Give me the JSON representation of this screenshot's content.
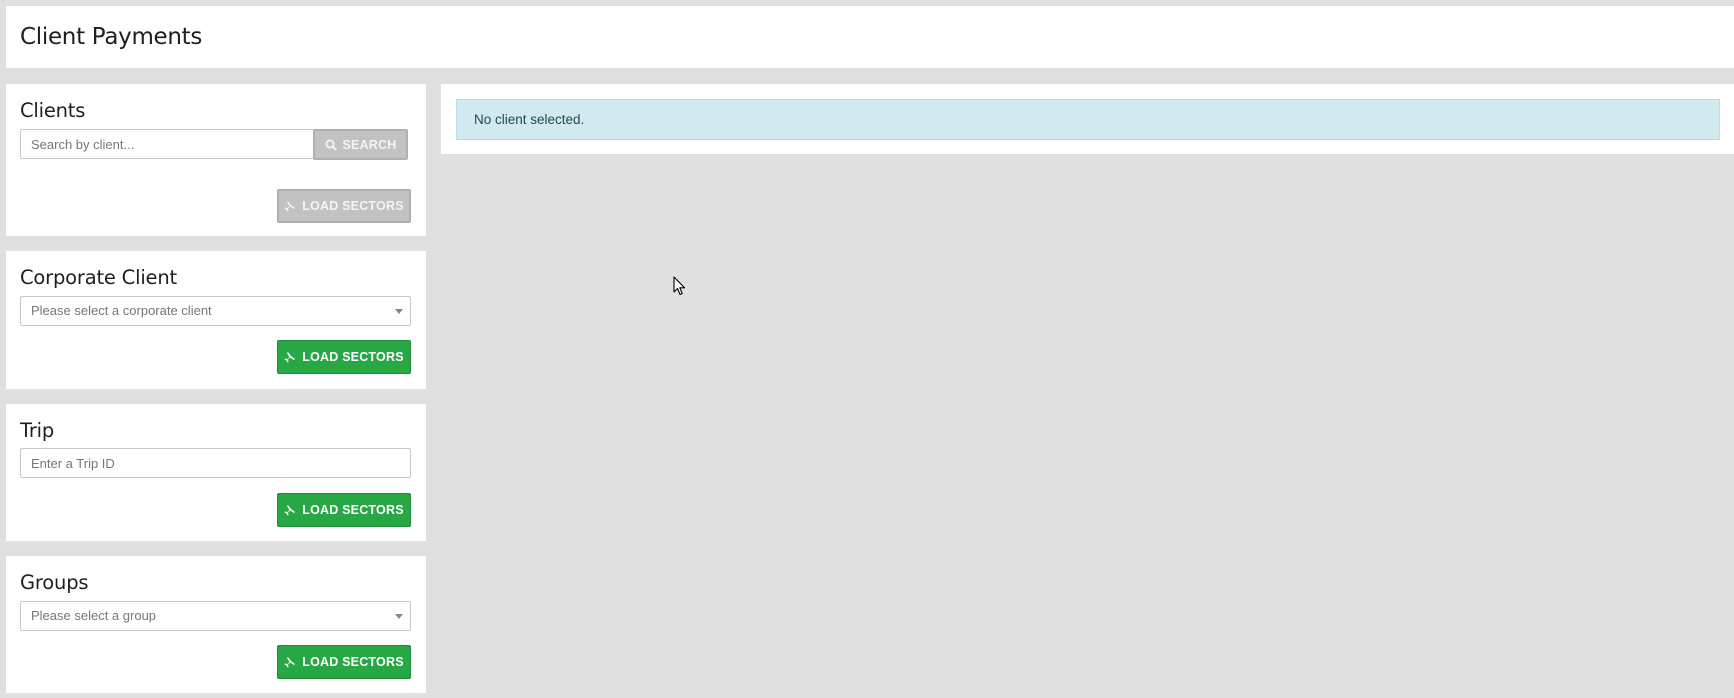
{
  "page": {
    "title": "Client Payments"
  },
  "clients_panel": {
    "heading": "Clients",
    "search_placeholder": "Search by client...",
    "search_button": "Search",
    "load_button": "Load Sectors"
  },
  "corporate_panel": {
    "heading": "Corporate Client",
    "select_value": "Please select a corporate client",
    "load_button": "Load Sectors"
  },
  "trip_panel": {
    "heading": "Trip",
    "input_placeholder": "Enter a Trip ID",
    "load_button": "Load Sectors"
  },
  "groups_panel": {
    "heading": "Groups",
    "select_value": "Please select a group",
    "load_button": "Load Sectors"
  },
  "main": {
    "alert_text": "No client selected."
  },
  "colors": {
    "background": "#dfe0df",
    "button_green": "#28a745",
    "button_disabled": "#c2c2c2",
    "alert_bg": "#d1e9ef"
  },
  "icons": {
    "search": "search-icon",
    "plane": "plane-icon",
    "select_caret": "chevron-down-icon"
  }
}
